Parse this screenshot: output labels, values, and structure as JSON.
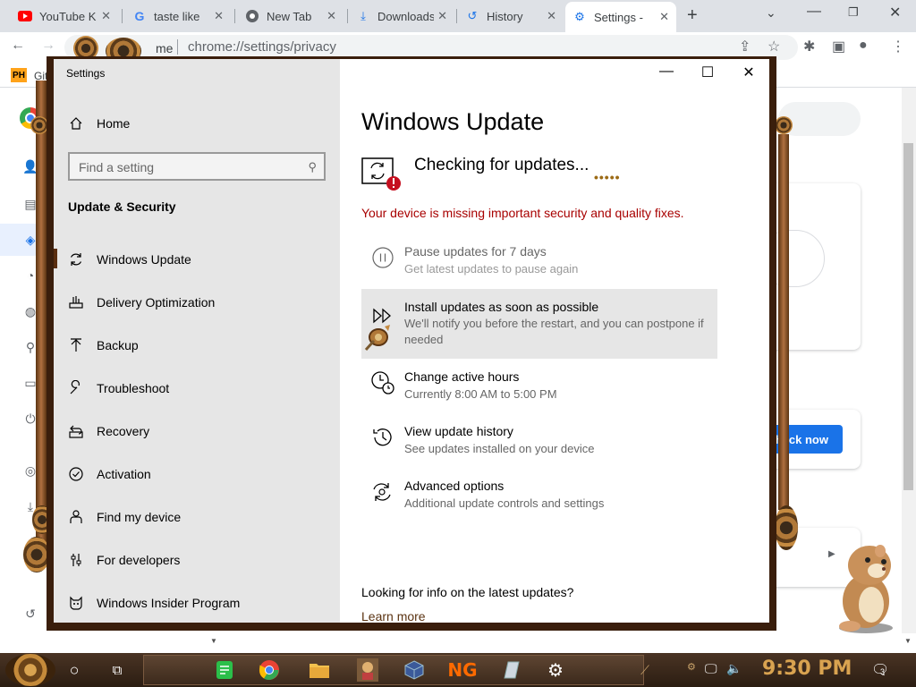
{
  "browser": {
    "tabs": [
      {
        "title": "YouTube K",
        "icon": "youtube-icon"
      },
      {
        "title": "taste like",
        "icon": "google-icon"
      },
      {
        "title": "New Tab",
        "icon": "chrome-icon"
      },
      {
        "title": "Downloads",
        "icon": "download-icon"
      },
      {
        "title": "History",
        "icon": "history-icon"
      },
      {
        "title": "Settings -",
        "icon": "settings-gear-icon",
        "active": true
      }
    ],
    "address_partial": "me",
    "url": "chrome://settings/privacy",
    "bookmark_label": "Git",
    "bookmark_badge": "PH",
    "check_now_label": "heck now"
  },
  "window": {
    "title": "Settings",
    "controls": {
      "minimize": "—",
      "maximize": "☐",
      "close": "✕"
    }
  },
  "nav": {
    "home": "Home",
    "search_placeholder": "Find a setting",
    "section": "Update & Security",
    "items": [
      {
        "label": "Windows Update",
        "icon": "refresh-icon"
      },
      {
        "label": "Delivery Optimization",
        "icon": "delivery-icon"
      },
      {
        "label": "Backup",
        "icon": "backup-arrow-icon"
      },
      {
        "label": "Troubleshoot",
        "icon": "wrench-icon"
      },
      {
        "label": "Recovery",
        "icon": "recovery-icon"
      },
      {
        "label": "Activation",
        "icon": "check-circle-icon"
      },
      {
        "label": "Find my device",
        "icon": "person-pin-icon"
      },
      {
        "label": "For developers",
        "icon": "developer-sliders-icon"
      },
      {
        "label": "Windows Insider Program",
        "icon": "insider-cat-icon"
      }
    ]
  },
  "main": {
    "title": "Windows Update",
    "status": "Checking for updates...",
    "warning": "Your device is missing important security and quality fixes.",
    "options": [
      {
        "title": "Pause updates for 7 days",
        "subtitle": "Get latest updates to pause again",
        "icon": "pause-circle-icon"
      },
      {
        "title": "Install updates as soon as possible",
        "subtitle": "We'll notify you before the restart, and you can postpone if needed",
        "icon": "fast-forward-icon"
      },
      {
        "title": "Change active hours",
        "subtitle": "Currently 8:00 AM to 5:00 PM",
        "icon": "clock-icon"
      },
      {
        "title": "View update history",
        "subtitle": "See updates installed on your device",
        "icon": "history-icon"
      },
      {
        "title": "Advanced options",
        "subtitle": "Additional update controls and settings",
        "icon": "gear-refresh-icon"
      }
    ],
    "info_heading": "Looking for info on the latest updates?",
    "learn_more": "Learn more"
  },
  "taskbar": {
    "time": "9:30 PM",
    "notification_count": "3"
  },
  "colors": {
    "warning_red": "#a80000",
    "nav_bg": "#e6e6e6",
    "frame_brown": "#3a1e0c",
    "chrome_blue": "#1a73e8"
  }
}
